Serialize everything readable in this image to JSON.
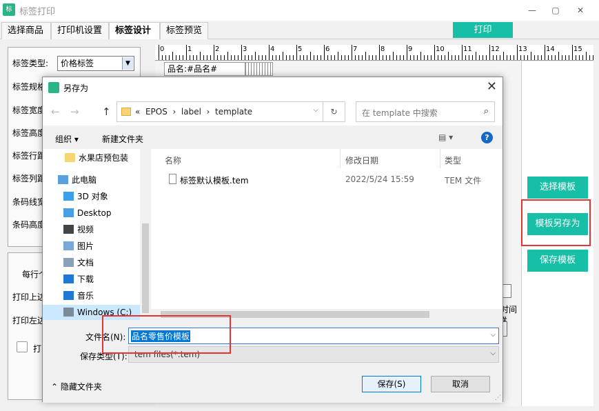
{
  "app": {
    "title": "标签打印",
    "icon_text": "标",
    "minimize": "—",
    "maximize": "▢",
    "close": "✕"
  },
  "tabs": [
    {
      "label": "选择商品"
    },
    {
      "label": "打印机设置"
    },
    {
      "label": "标签设计"
    },
    {
      "label": "标签预览"
    }
  ],
  "print_button": "打印",
  "left_panel": {
    "label_type_label": "标签类型:",
    "label_type_value": "价格标签",
    "labels": [
      "标签规格",
      "标签宽度",
      "标签高度",
      "标签行距",
      "标签列距",
      "条码线宽",
      "条码高度"
    ],
    "lower_labels": [
      "每行个",
      "打印上边",
      "打印左边",
      "打印"
    ]
  },
  "ruler": {
    "ticks": [
      "0",
      "1",
      "2",
      "3",
      "4",
      "5",
      "6",
      "7",
      "8",
      "9",
      "10",
      "11",
      "12",
      "13",
      "14",
      "15"
    ]
  },
  "canvas": {
    "cell_text": "品名:#品名#",
    "right_text": "时间#"
  },
  "side_buttons": {
    "choose_template": "选择模板",
    "save_as_template": "模板另存为",
    "save_template": "保存模板"
  },
  "dialog": {
    "title": "另存为",
    "address": "«  EPOS  ›  label  ›  template",
    "search_placeholder": "在 template 中搜索",
    "toolbar": {
      "organize": "组织 ▾",
      "new_folder": "新建文件夹",
      "view": "▤ ▾",
      "help": "?"
    },
    "nav_items": [
      {
        "label": "水果店预包装",
        "icon": "folder-icon",
        "color": "#f7d474"
      },
      {
        "label": "此电脑",
        "icon": "computer-icon",
        "color": "#5aa0e0"
      },
      {
        "label": "3D 对象",
        "icon": "3d-objects-icon",
        "color": "#3aa0e8"
      },
      {
        "label": "Desktop",
        "icon": "desktop-icon",
        "color": "#4a9ee6"
      },
      {
        "label": "视频",
        "icon": "video-icon",
        "color": "#444444"
      },
      {
        "label": "图片",
        "icon": "pictures-icon",
        "color": "#7aa7d8"
      },
      {
        "label": "文档",
        "icon": "documents-icon",
        "color": "#8aa0bb"
      },
      {
        "label": "下载",
        "icon": "download-icon",
        "color": "#1e78d4"
      },
      {
        "label": "音乐",
        "icon": "music-icon",
        "color": "#1e78d4"
      },
      {
        "label": "Windows (C:)",
        "icon": "drive-icon",
        "color": "#7a8a99"
      }
    ],
    "columns": {
      "name": "名称",
      "date": "修改日期",
      "type": "类型"
    },
    "files": [
      {
        "name": "标签默认模板.tem",
        "date": "2022/5/24 15:59",
        "type": "TEM 文件"
      }
    ],
    "filename_label": "文件名(N):",
    "filename_value": "品名零售价模板",
    "filetype_label": "保存类型(T):",
    "filetype_value": "tem files(*.tem)",
    "hide_folders": "隐藏文件夹",
    "save_button": "保存(S)",
    "cancel_button": "取消"
  }
}
